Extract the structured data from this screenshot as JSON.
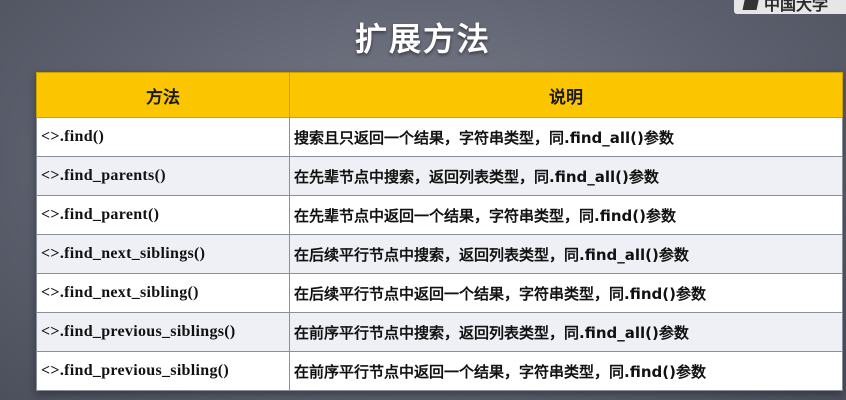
{
  "logo": {
    "text": "中国大学"
  },
  "slide": {
    "title": "扩展方法"
  },
  "table": {
    "headers": [
      "方法",
      "说明"
    ],
    "rows": [
      {
        "method": "<>.find()",
        "description": "搜索且只返回一个结果，字符串类型，同.find_all()参数"
      },
      {
        "method": "<>.find_parents()",
        "description": "在先辈节点中搜索，返回列表类型，同.find_all()参数"
      },
      {
        "method": "<>.find_parent()",
        "description": "在先辈节点中返回一个结果，字符串类型，同.find()参数"
      },
      {
        "method": "<>.find_next_siblings()",
        "description": "在后续平行节点中搜索，返回列表类型，同.find_all()参数"
      },
      {
        "method": "<>.find_next_sibling()",
        "description": "在后续平行节点中返回一个结果，字符串类型，同.find()参数"
      },
      {
        "method": "<>.find_previous_siblings()",
        "description": "在前序平行节点中搜索，返回列表类型，同.find_all()参数"
      },
      {
        "method": "<>.find_previous_sibling()",
        "description": "在前序平行节点中返回一个结果，字符串类型，同.find()参数"
      }
    ]
  },
  "colors": {
    "header_bg": "#fbc500",
    "slide_bg": "#5f6270",
    "title_text": "#ffffff"
  }
}
